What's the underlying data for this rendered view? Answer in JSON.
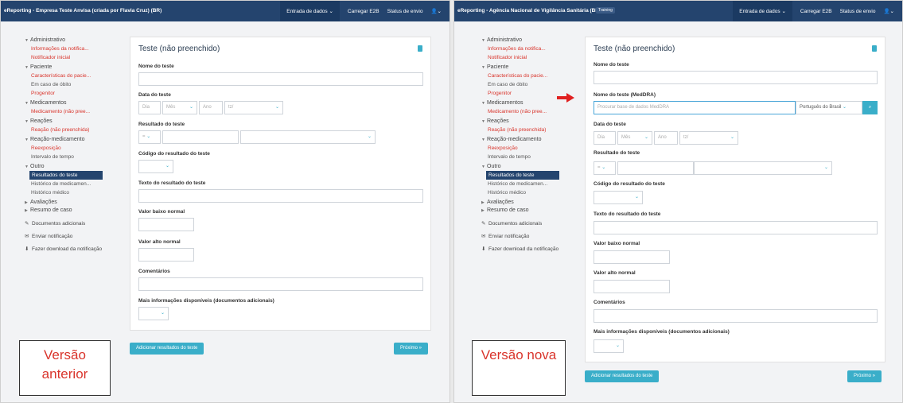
{
  "left": {
    "app_title": "eReporting - Empresa Teste Anvisa (criada por Flavia Cruz) (BR)",
    "nav": [
      "Entrada de dados",
      "Carregar E2B",
      "Status de envio"
    ],
    "sidebar": {
      "administrativo": "Administrativo",
      "admin_items": [
        "Informações da notifica...",
        "Notificador inicial"
      ],
      "paciente": "Paciente",
      "paciente_items": [
        "Características do pacie...",
        "Em caso de óbito",
        "Progenitor"
      ],
      "medicamentos": "Medicamentos",
      "med_items": [
        "Medicamento (não pree..."
      ],
      "reacoes": "Reações",
      "reac_items": [
        "Reação (não preenchida)"
      ],
      "reacmed": "Reação-medicamento",
      "reacmed_items": [
        "Reexposição",
        "Intervalo de tempo"
      ],
      "outro": "Outro",
      "outro_items": [
        "Resultados do teste",
        "Histórico de medicamen...",
        "Histórico médico"
      ],
      "avaliacoes": "Avaliações",
      "resumo": "Resumo de caso",
      "docs": "Documentos adicionais",
      "enviar": "Enviar notificação",
      "download": "Fazer download da notificação"
    },
    "card": {
      "title": "Teste (não preenchido)",
      "nome": "Nome do teste",
      "data": "Data do teste",
      "dia": "Dia",
      "mes": "Mês",
      "ano": "Ano",
      "tz": "tz/",
      "resultado": "Resultado do teste",
      "eq": "=",
      "codigo": "Código do resultado do teste",
      "texto": "Texto do resultado do teste",
      "baixo": "Valor baixo normal",
      "alto": "Valor alto normal",
      "coment": "Comentários",
      "mais": "Mais informações disponíveis (documentos adicionais)"
    },
    "btn_add": "Adicionar resultados do teste",
    "btn_next": "Próximo »",
    "version": "Versão anterior"
  },
  "right": {
    "app_title": "eReporting - Agência Nacional de Vigilância Sanitária (BR)",
    "badge": "Training",
    "nav": [
      "Entrada de dados",
      "Carregar E2B",
      "Status de envio"
    ],
    "sidebar": {
      "administrativo": "Administrativo",
      "admin_items": [
        "Informações da notifica...",
        "Notificador inicial"
      ],
      "paciente": "Paciente",
      "paciente_items": [
        "Características do pacie...",
        "Em caso de óbito",
        "Progenitor"
      ],
      "medicamentos": "Medicamentos",
      "med_items": [
        "Medicamento (não pree..."
      ],
      "reacoes": "Reações",
      "reac_items": [
        "Reação (não preenchida)"
      ],
      "reacmed": "Reação-medicamento",
      "reacmed_items": [
        "Reexposição",
        "Intervalo de tempo"
      ],
      "outro": "Outro",
      "outro_items": [
        "Resultados do teste",
        "Histórico de medicamen...",
        "Histórico médico"
      ],
      "avaliacoes": "Avaliações",
      "resumo": "Resumo de caso",
      "docs": "Documentos adicionais",
      "enviar": "Enviar notificação",
      "download": "Fazer download da notificação"
    },
    "card": {
      "title": "Teste (não preenchido)",
      "nome": "Nome do teste",
      "medra": "Nome do teste (MedDRA)",
      "medra_ph": "Procurar base de dados MedDRA",
      "lang": "Português do Brasil",
      "data": "Data do teste",
      "dia": "Dia",
      "mes": "Mês",
      "ano": "Ano",
      "tz": "tz/",
      "resultado": "Resultado do teste",
      "eq": "=",
      "codigo": "Código do resultado do teste",
      "texto": "Texto do resultado do teste",
      "baixo": "Valor baixo normal",
      "alto": "Valor alto normal",
      "coment": "Comentários",
      "mais": "Mais informações disponíveis (documentos adicionais)"
    },
    "btn_add": "Adicionar resultados do teste",
    "btn_next": "Próximo »",
    "version": "Versão nova"
  }
}
